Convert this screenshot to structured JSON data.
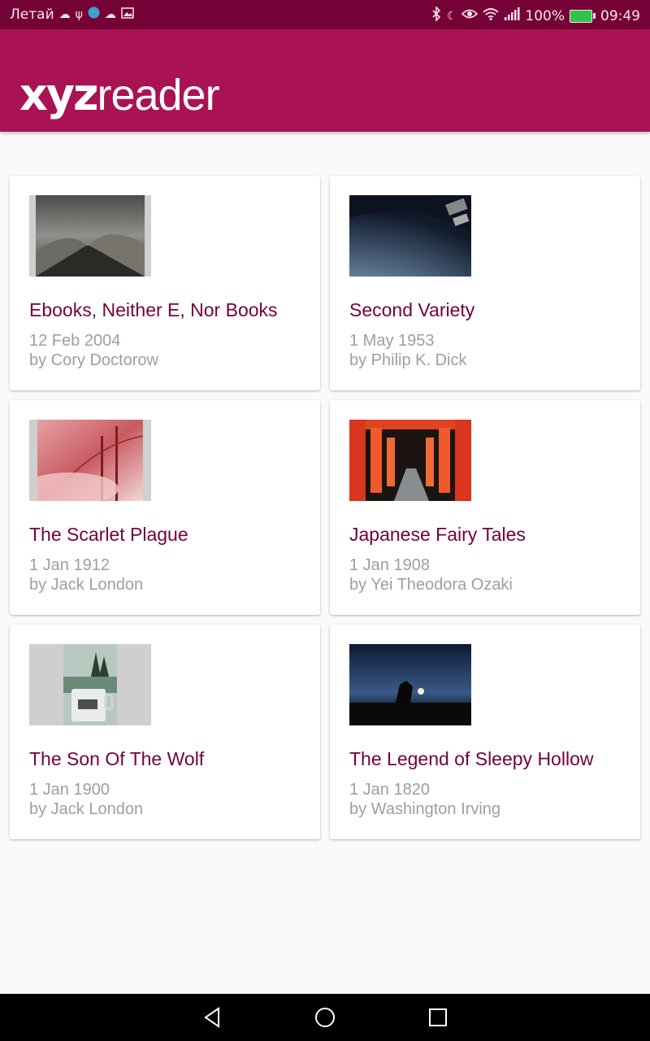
{
  "status_bar": {
    "carrier": "Летай",
    "battery": "100%",
    "time": "09:49",
    "icons_left": [
      "cloud-icon",
      "usb-icon",
      "globe-icon",
      "cloud-icon",
      "image-icon"
    ],
    "icons_right": [
      "bluetooth-icon",
      "moon-icon",
      "eye-icon",
      "wifi-icon",
      "signal-icon",
      "battery-icon"
    ],
    "colors": {
      "background": "#750236"
    }
  },
  "app_bar": {
    "logo_bold": "xyz",
    "logo_light": "reader",
    "colors": {
      "background": "#a91355"
    }
  },
  "articles": [
    {
      "title": "Ebooks, Neither E, Nor Books",
      "date": "12 Feb 2004",
      "author": "by Cory Doctorow",
      "thumb_colors": [
        "#6e706c",
        "#2b2d2a",
        "#8d8b85"
      ]
    },
    {
      "title": "Second Variety",
      "date": "1 May 1953",
      "author": "by Philip K. Dick",
      "thumb_colors": [
        "#1a2433",
        "#5f7c9b",
        "#c8d3dc"
      ]
    },
    {
      "title": "The Scarlet Plague",
      "date": "1 Jan 1912",
      "author": "by Jack London",
      "thumb_colors": [
        "#e9b6b6",
        "#c0404a",
        "#f2d4d2"
      ]
    },
    {
      "title": "Japanese Fairy Tales",
      "date": "1 Jan 1908",
      "author": "by Yei Theodora Ozaki",
      "thumb_colors": [
        "#d9361d",
        "#1b1410",
        "#f05a2b"
      ]
    },
    {
      "title": "The Son Of The Wolf",
      "date": "1 Jan 1900",
      "author": "by Jack London",
      "thumb_colors": [
        "#9bb0a4",
        "#3e5142",
        "#e7ece8"
      ]
    },
    {
      "title": "The Legend of Sleepy Hollow",
      "date": "1 Jan 1820",
      "author": "by Washington Irving",
      "thumb_colors": [
        "#0c1a33",
        "#3a5a87",
        "#111111"
      ]
    }
  ],
  "nav_bar": {
    "icons": [
      "back-icon",
      "home-icon",
      "recents-icon"
    ]
  },
  "colors": {
    "accent": "#a91355",
    "title_text": "#750236",
    "meta_text": "#9e9e9e",
    "background": "#fafafa"
  }
}
